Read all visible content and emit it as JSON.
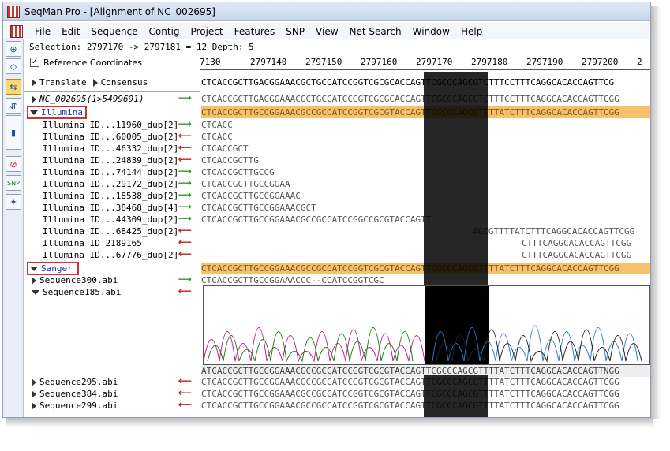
{
  "window": {
    "title": "SeqMan Pro - [Alignment of NC_002695]"
  },
  "menu": [
    "File",
    "Edit",
    "Sequence",
    "Contig",
    "Project",
    "Features",
    "SNP",
    "View",
    "Net Search",
    "Window",
    "Help"
  ],
  "info": {
    "selection_text": "Selection: 2797170 -> 2797181 = 12 Depth: 5"
  },
  "reference_coordinates": {
    "label": "Reference Coordinates",
    "checked": true
  },
  "ruler": {
    "labels": [
      "7130",
      "2797140",
      "2797150",
      "2797160",
      "2797170",
      "2797180",
      "2797190",
      "2797200",
      "2"
    ]
  },
  "tools": [
    "zoom-in-icon",
    "zoom-out-icon",
    "align-icon",
    "pairwise-icon",
    "slider-icon",
    "no-entry-icon",
    "snp-icon",
    "compass-icon"
  ],
  "header_row": {
    "translate": "Translate",
    "consensus": "Consensus",
    "consensus_seq": "CTCACCGCTTGACGGAAACGCTGCCATCCGGTCGCGCACCAGTTCGCCCAGCGTCTTTCCTTTCAGGCACACCAGTTCG"
  },
  "reference": {
    "name": "NC_002695(1>5499691)",
    "seq": "CTCACCGCTTGACGGAAACGCTGCCATCCGGTCGCGCACCAGTTCGCCCAGCGTCTTTCCTTTCAGGCACACCAGTTCGG"
  },
  "groups": [
    {
      "name": "Illumina",
      "consensus": "CTCACCGCTTGCCGGAAACGCCGCCATCCGGTCGCGTACCAGTTCGCCCAGCGTTTTATCTTTCAGGCACACCAGTTCGG"
    },
    {
      "name": "Sanger",
      "consensus": "CTCACCGCTTGCCGGAAACGCCGCCATCCGGTCGCGTACCAGTTCGCCCAGCGTTTTATCTTTCAGGCACACCAGTTCGG"
    }
  ],
  "illumina_reads": [
    {
      "name": "Illumina ID...11960_dup[2]",
      "dir": "fwd",
      "seq": "CTCACC"
    },
    {
      "name": "Illumina ID...60005_dup[2]",
      "dir": "rev",
      "seq": "CTCACC"
    },
    {
      "name": "Illumina ID...46332_dup[2]",
      "dir": "rev",
      "seq": "CTCACCGCT"
    },
    {
      "name": "Illumina ID...24839_dup[2]",
      "dir": "rev",
      "seq": "CTCACCGCTTG"
    },
    {
      "name": "Illumina ID...74144_dup[2]",
      "dir": "fwd",
      "seq": "CTCACCGCTTGCCG"
    },
    {
      "name": "Illumina ID...29172_dup[2]",
      "dir": "fwd",
      "seq": "CTCACCGCTTGCCGGAA"
    },
    {
      "name": "Illumina ID...18538_dup[2]",
      "dir": "fwd",
      "seq": "CTCACCGCTTGCCGGAAAC"
    },
    {
      "name": "Illumina ID...38468_dup[4]",
      "dir": "fwd",
      "seq": "CTCACCGCTTGCCGGAAACGCT"
    },
    {
      "name": "Illumina ID...44309_dup[2]",
      "dir": "fwd",
      "seq": "CTCACCGCTTGCCGGAAACGCCGCCATCCGGCCGCGTACCAGTT"
    },
    {
      "name": "Illumina ID...68425_dup[2]",
      "dir": "rev",
      "seq": "AGCGTTTTATCTTTCAGGCACACCAGTTCGG"
    },
    {
      "name": "Illumina ID_2189165",
      "dir": "rev",
      "seq": "CTTTCAGGCACACCAGTTCGG"
    },
    {
      "name": "Illumina ID...67776_dup[2]",
      "dir": "rev",
      "seq": "CTTTCAGGCACACCAGTTCGG"
    }
  ],
  "sanger_reads": [
    {
      "name": "Sequence300.abi",
      "dir": "fwd",
      "seq": "CTCACCGCTTGCCGGAAACCC--CCATCCGGTCGC"
    },
    {
      "name": "Sequence185.abi",
      "dir": "rev",
      "seq": "ATCACCGCTTGCCGGAAACGCCGCCATCCGGTCGCGTACCAGTTCGCCCAGCGTTTTATCTTTCAGGCACACCAGTTNGG"
    },
    {
      "name": "Sequence295.abi",
      "dir": "rev",
      "seq": "CTCACCGCTTGCCGGAAACGCCGCCATCCGGTCGCGTACCAGTTCGCCCAGCGTTTTATCTTTCAGGCACACCAGTTCGG"
    },
    {
      "name": "Sequence384.abi",
      "dir": "rev",
      "seq": "CTCACCGCTTGCCGGAAACGCCGCCATCCGGTCGCGTACCAGTTCGCCCAGCGTTTTATCTTTCAGGCACACCAGTTCGG"
    },
    {
      "name": "Sequence299.abi",
      "dir": "rev",
      "seq": "CTCACCGCTTGCCGGAAACGCCGCCATCCGGTCGCGTACCAGTTCGCCCAGCGTTTTATCTTTCAGGCACACCAGTTCGG"
    }
  ],
  "colors": {
    "highlight": "#000000",
    "consensus_bg": "#f7c06a",
    "snp_blue": "#1a2fc0",
    "fwd_arrow": "#2a9a2a",
    "rev_arrow": "#c32020"
  }
}
